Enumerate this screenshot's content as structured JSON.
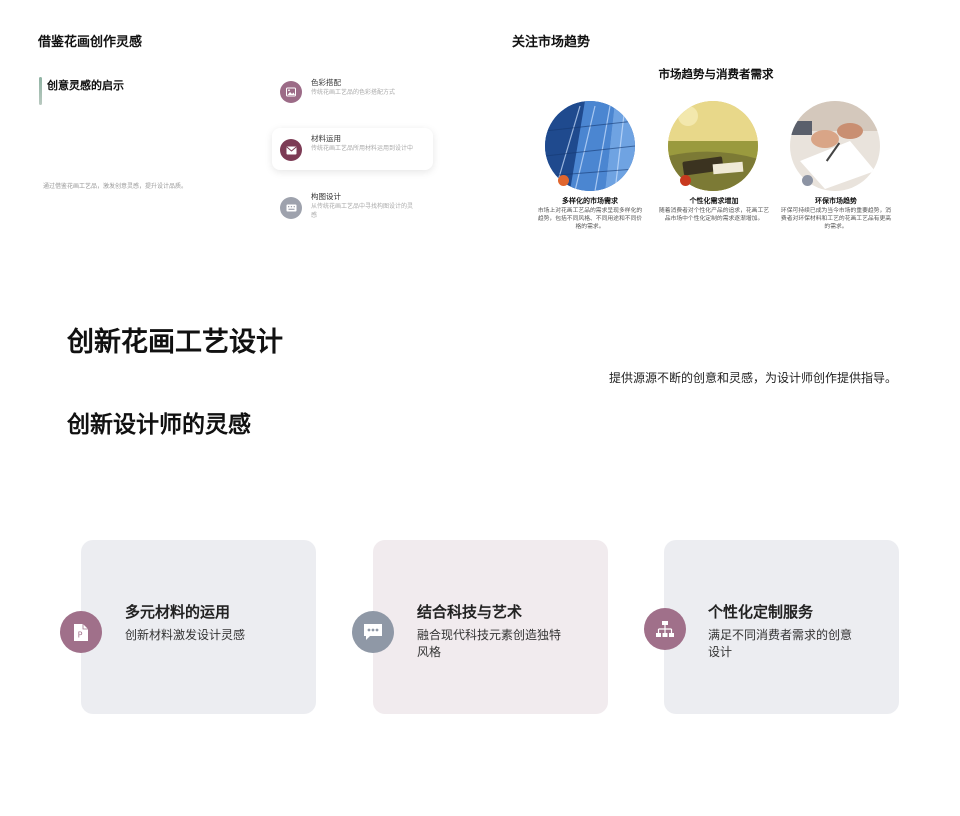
{
  "slide1": {
    "title": "借鉴花画创作灵感",
    "subtitle": "创意灵感的启示",
    "caption": "通过借鉴花画工艺品，激发创意灵感，提升设计品质。",
    "items": [
      {
        "title": "色彩搭配",
        "desc": "传统花画工艺品的色彩搭配方式",
        "icon": "image-icon",
        "color": "#9c6b87"
      },
      {
        "title": "材料运用",
        "desc": "传统花画工艺品所用材料运用到设计中",
        "icon": "mail-icon",
        "color": "#7d3b55"
      },
      {
        "title": "构图设计",
        "desc": "从传统花画工艺品中寻找构图设计的灵感",
        "icon": "keyboard-icon",
        "color": "#9ea2ad"
      }
    ]
  },
  "slide2": {
    "title": "关注市场趋势",
    "heading": "市场趋势与消费者需求",
    "columns": [
      {
        "title": "多样化的市场需求",
        "desc": "市场上对花画工艺品的需求呈现多样化的趋势，包括不同风格、不同用途和不同价格的需求。",
        "dot_color": "#e0662e"
      },
      {
        "title": "个性化需求增加",
        "desc": "随着消费者对个性化产品的追求，花画工艺品市场中个性化定制的需求逐渐增加。",
        "dot_color": "#c8391e"
      },
      {
        "title": "环保市场趋势",
        "desc": "环保可持续已成为当今市场的重要趋势，消费者对环保材料和工艺的花画工艺品有更高的需求。",
        "dot_color": "#8c93a3"
      }
    ]
  },
  "middle": {
    "main_title": "创新花画工艺设计",
    "tagline": "提供源源不断的创意和灵感，为设计师创作提供指导。",
    "second_title": "创新设计师的灵感"
  },
  "features": [
    {
      "title": "多元材料的运用",
      "desc": "创新材料激发设计灵感",
      "icon": "document-icon",
      "icon_color": "#a0708a",
      "bg": "#ecedf1"
    },
    {
      "title": "结合科技与艺术",
      "desc": "融合现代科技元素创造独特风格",
      "icon": "chat-icon",
      "icon_color": "#8f98a6",
      "bg": "#f1ebee"
    },
    {
      "title": "个性化定制服务",
      "desc": "满足不同消费者需求的创意设计",
      "icon": "sitemap-icon",
      "icon_color": "#a0708a",
      "bg": "#ecedf1"
    }
  ]
}
